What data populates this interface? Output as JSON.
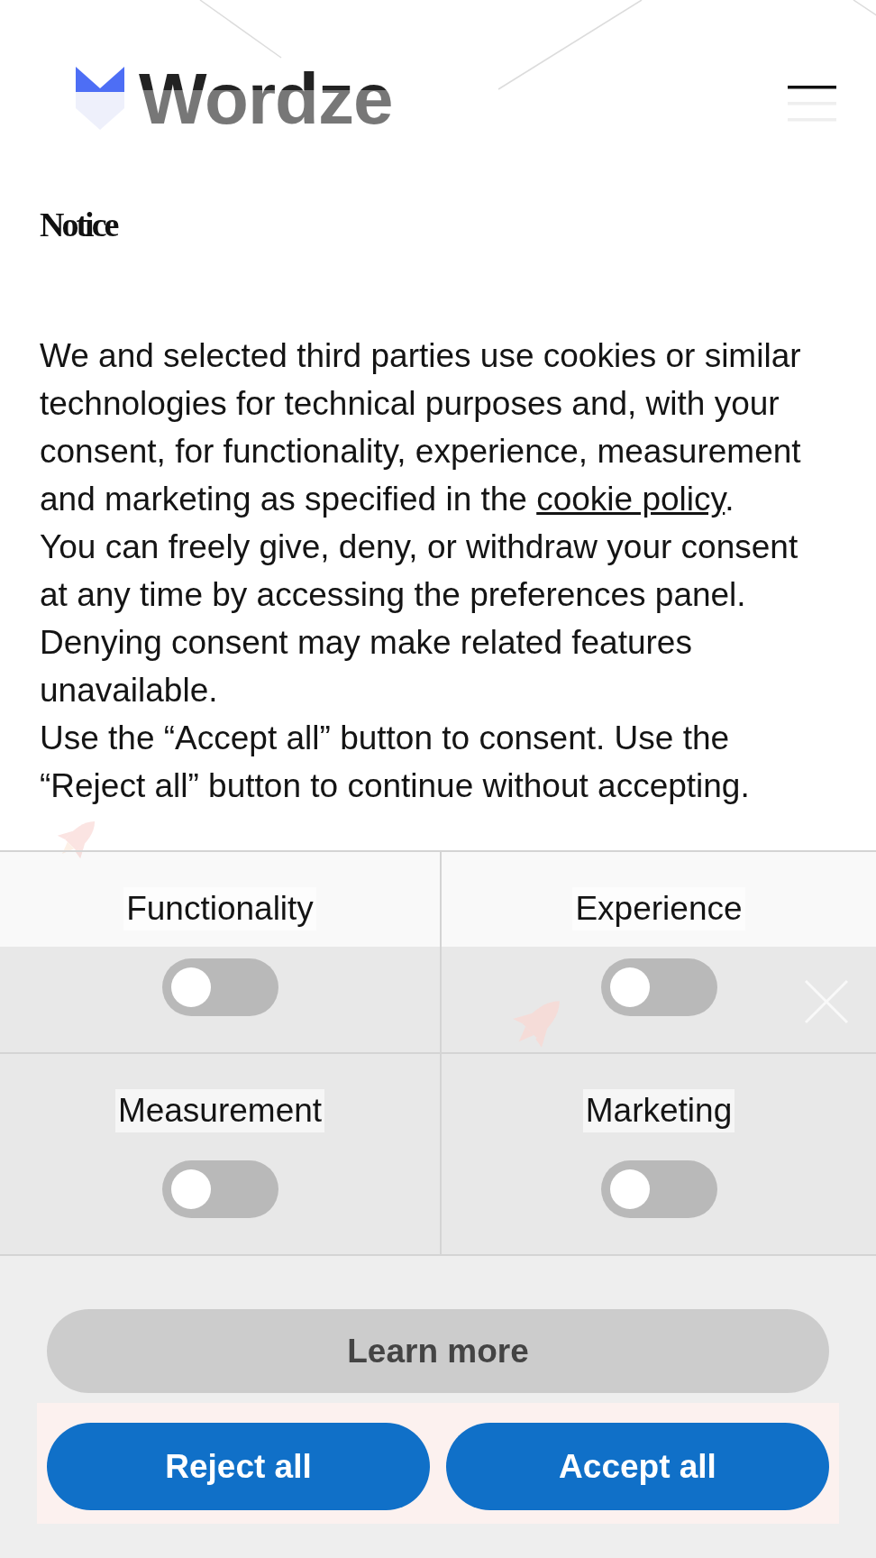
{
  "page": {
    "logo": "Wordze"
  },
  "consent": {
    "title": "Notice",
    "intro": {
      "text": "We and selected third parties use cookies or similar technologies for technical purposes and, with your consent, for functionality, experience, measurement and marketing as specified in the ",
      "link": "cookie policy",
      "after": "."
    },
    "paragraphs": [
      "You can freely give, deny, or withdraw your consent at any time by accessing the preferences panel.",
      "Denying consent may make related features unavailable.",
      "Use the “Accept all” button to consent. Use the “Reject all” button to continue without accepting."
    ],
    "purposes": [
      {
        "label": "Functionality",
        "on": false
      },
      {
        "label": "Experience",
        "on": false
      },
      {
        "label": "Measurement",
        "on": false
      },
      {
        "label": "Marketing",
        "on": false
      }
    ],
    "buttons": [
      {
        "label": "Learn more",
        "kind": "secondary"
      },
      {
        "label": "Reject all",
        "kind": "primary"
      },
      {
        "label": "Accept all",
        "kind": "primary"
      }
    ]
  }
}
